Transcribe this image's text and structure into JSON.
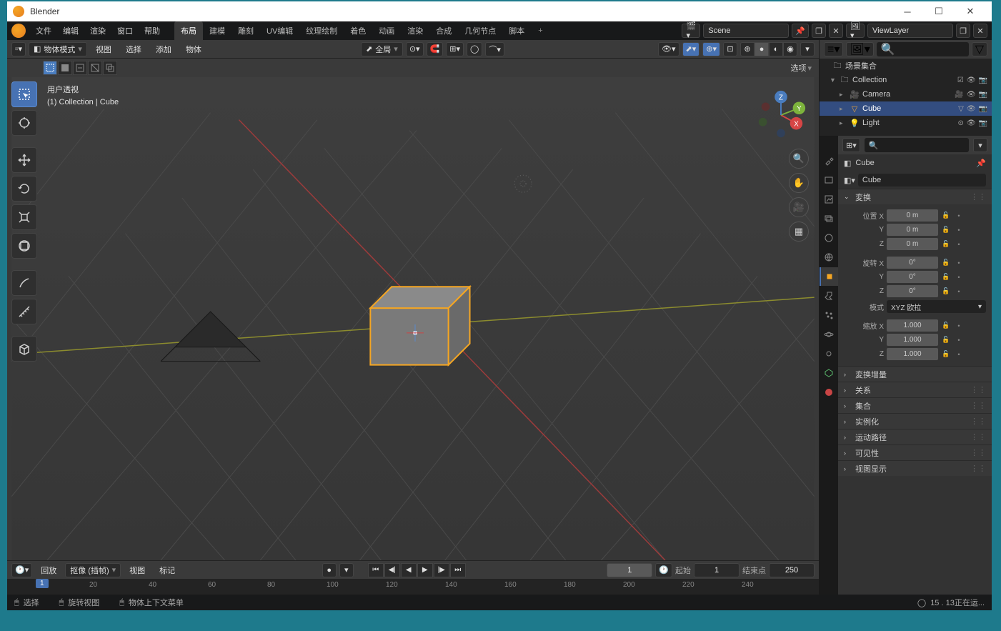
{
  "window": {
    "title": "Blender"
  },
  "top_menus": [
    "文件",
    "编辑",
    "渲染",
    "窗口",
    "帮助"
  ],
  "workspaces": [
    "布局",
    "建模",
    "雕刻",
    "UV编辑",
    "纹理绘制",
    "着色",
    "动画",
    "渲染",
    "合成",
    "几何节点",
    "脚本"
  ],
  "active_workspace": "布局",
  "scene_field": "Scene",
  "viewlayer_field": "ViewLayer",
  "viewport": {
    "mode": "物体模式",
    "header_menus": [
      "视图",
      "选择",
      "添加",
      "物体"
    ],
    "orientation": "全局",
    "options": "选项",
    "overlay_title": "用户透视",
    "overlay_path": "(1) Collection | Cube"
  },
  "timeline": {
    "menus": [
      "回放",
      "抠像 (插帧)",
      "视图",
      "标记"
    ],
    "current": "1",
    "start_label": "起始",
    "start": "1",
    "end_label": "结束点",
    "end": "250",
    "ticks": [
      "20",
      "40",
      "60",
      "80",
      "100",
      "120",
      "140",
      "160",
      "180",
      "200",
      "220",
      "240"
    ]
  },
  "statusbar": {
    "select": "选择",
    "rotate": "旋转视图",
    "context": "物体上下文菜单",
    "version": "15 . 13正在运..."
  },
  "outliner": {
    "root": "场景集合",
    "collection": "Collection",
    "items": [
      {
        "name": "Camera",
        "icon": "camera",
        "selected": false
      },
      {
        "name": "Cube",
        "icon": "mesh",
        "selected": true
      },
      {
        "name": "Light",
        "icon": "light",
        "selected": false
      }
    ]
  },
  "properties": {
    "breadcrumb": "Cube",
    "data_name": "Cube",
    "panels": {
      "transform": "変换",
      "position": {
        "label": "位置",
        "x": "0 m",
        "y": "0 m",
        "z": "0 m"
      },
      "rotation": {
        "label": "旋转",
        "x": "0°",
        "y": "0°",
        "z": "0°"
      },
      "mode": {
        "label": "模式",
        "value": "XYZ 欧拉"
      },
      "scale": {
        "label": "缩放",
        "x": "1.000",
        "y": "1.000",
        "z": "1.000"
      },
      "delta": "変换增量",
      "relations": "关系",
      "collections": "集合",
      "instancing": "实例化",
      "motion": "运动路径",
      "visibility": "可见性",
      "viewport_display": "视图显示"
    }
  }
}
